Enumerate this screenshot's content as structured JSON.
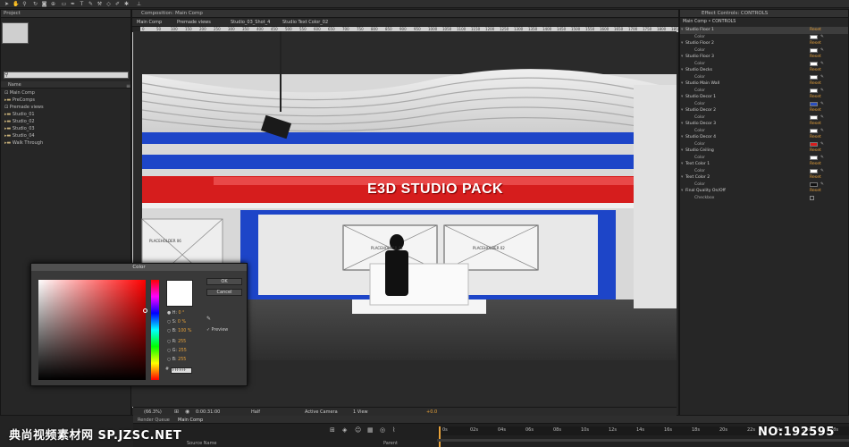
{
  "project_panel": {
    "title": "Project",
    "search_placeholder": "",
    "column_name": "Name",
    "items": [
      {
        "label": "Main Comp"
      },
      {
        "label": "PreComps"
      },
      {
        "label": "Premade views"
      },
      {
        "label": "Studio_01"
      },
      {
        "label": "Studio_02"
      },
      {
        "label": "Studio_03"
      },
      {
        "label": "Studio_04"
      },
      {
        "label": "Walk Through"
      }
    ]
  },
  "composition": {
    "panel_title": "Composition: Main Comp",
    "breadcrumbs": [
      "Main Comp",
      "Premade views",
      "Studio_03_Shot_4",
      "Studio Text Color_02"
    ],
    "ruler_numbers": [
      "0",
      "50",
      "100",
      "150",
      "200",
      "250",
      "300",
      "350",
      "400",
      "450",
      "500",
      "550",
      "600",
      "650",
      "700",
      "750",
      "800",
      "850",
      "900",
      "950",
      "1000",
      "1050",
      "1100",
      "1150",
      "1200",
      "1250",
      "1300",
      "1350",
      "1400",
      "1450",
      "1500",
      "1550",
      "1600",
      "1650",
      "1700",
      "1750",
      "1800",
      "1850"
    ],
    "scene_title": "E3D STUDIO PACK",
    "placeholders": [
      "PLACEHOLDER 06",
      "PLACEHOLDER 01",
      "PLACEHOLDER 02"
    ],
    "footer": {
      "zoom": "(66.3%)",
      "timecode": "0:00:31:00",
      "resolution": "Half",
      "camera": "Active Camera",
      "views": "1 View",
      "exposure": "+0.0"
    }
  },
  "effect_controls": {
    "title": "Effect Controls: CONTROLS",
    "subtitle": "Main Comp • CONTROLS",
    "reset_label": "Reset",
    "items": [
      {
        "name": "Studio Floor 1",
        "sub": "Color",
        "color": "#ffffff"
      },
      {
        "name": "Studio Floor 2",
        "sub": "Color",
        "color": "#ffffff"
      },
      {
        "name": "Studio Floor 3",
        "sub": "Color",
        "color": "#ffffff"
      },
      {
        "name": "Studio Decks",
        "sub": "Color",
        "color": "#ffffff"
      },
      {
        "name": "Studio Main Wall",
        "sub": "Color",
        "color": "#ffffff"
      },
      {
        "name": "Studio Decor 1",
        "sub": "Color",
        "color": "#2a4fc0"
      },
      {
        "name": "Studio Decor 2",
        "sub": "Color",
        "color": "#ffffff"
      },
      {
        "name": "Studio Decor 3",
        "sub": "Color",
        "color": "#ffffff"
      },
      {
        "name": "Studio Decor 4",
        "sub": "Color",
        "color": "#d81c1c"
      },
      {
        "name": "Studio Ceiling",
        "sub": "Color",
        "color": "#ffffff"
      },
      {
        "name": "Text Color 1",
        "sub": "Color",
        "color": "#ffffff"
      },
      {
        "name": "Text Color 2",
        "sub": "Color",
        "color": "#111111"
      },
      {
        "name": "Final Quality On/Off",
        "sub": "Checkbox",
        "color": ""
      }
    ]
  },
  "color_dialog": {
    "title": "Color",
    "ok_label": "OK",
    "cancel_label": "Cancel",
    "preview_label": "Preview",
    "fields": [
      {
        "label": "H:",
        "value": "0 °"
      },
      {
        "label": "S:",
        "value": "0 %"
      },
      {
        "label": "B:",
        "value": "100 %"
      },
      {
        "label": "R:",
        "value": "255"
      },
      {
        "label": "G:",
        "value": "255"
      },
      {
        "label": "B:",
        "value": "255"
      }
    ],
    "hex_value": "FFFFFF",
    "selected_color": "#ffffff"
  },
  "timeline": {
    "tabs": [
      "Render Queue",
      "Main Comp"
    ],
    "column_label": "Source Name",
    "parent_label": "Parent",
    "ticks": [
      "0s",
      "02s",
      "04s",
      "06s",
      "08s",
      "10s",
      "12s",
      "14s",
      "16s",
      "18s",
      "20s",
      "22s",
      "24s",
      "26s",
      "28s"
    ]
  },
  "watermark": {
    "left": "典尚视频素材网 SP.JZSC.NET",
    "right": "NO:192595"
  }
}
